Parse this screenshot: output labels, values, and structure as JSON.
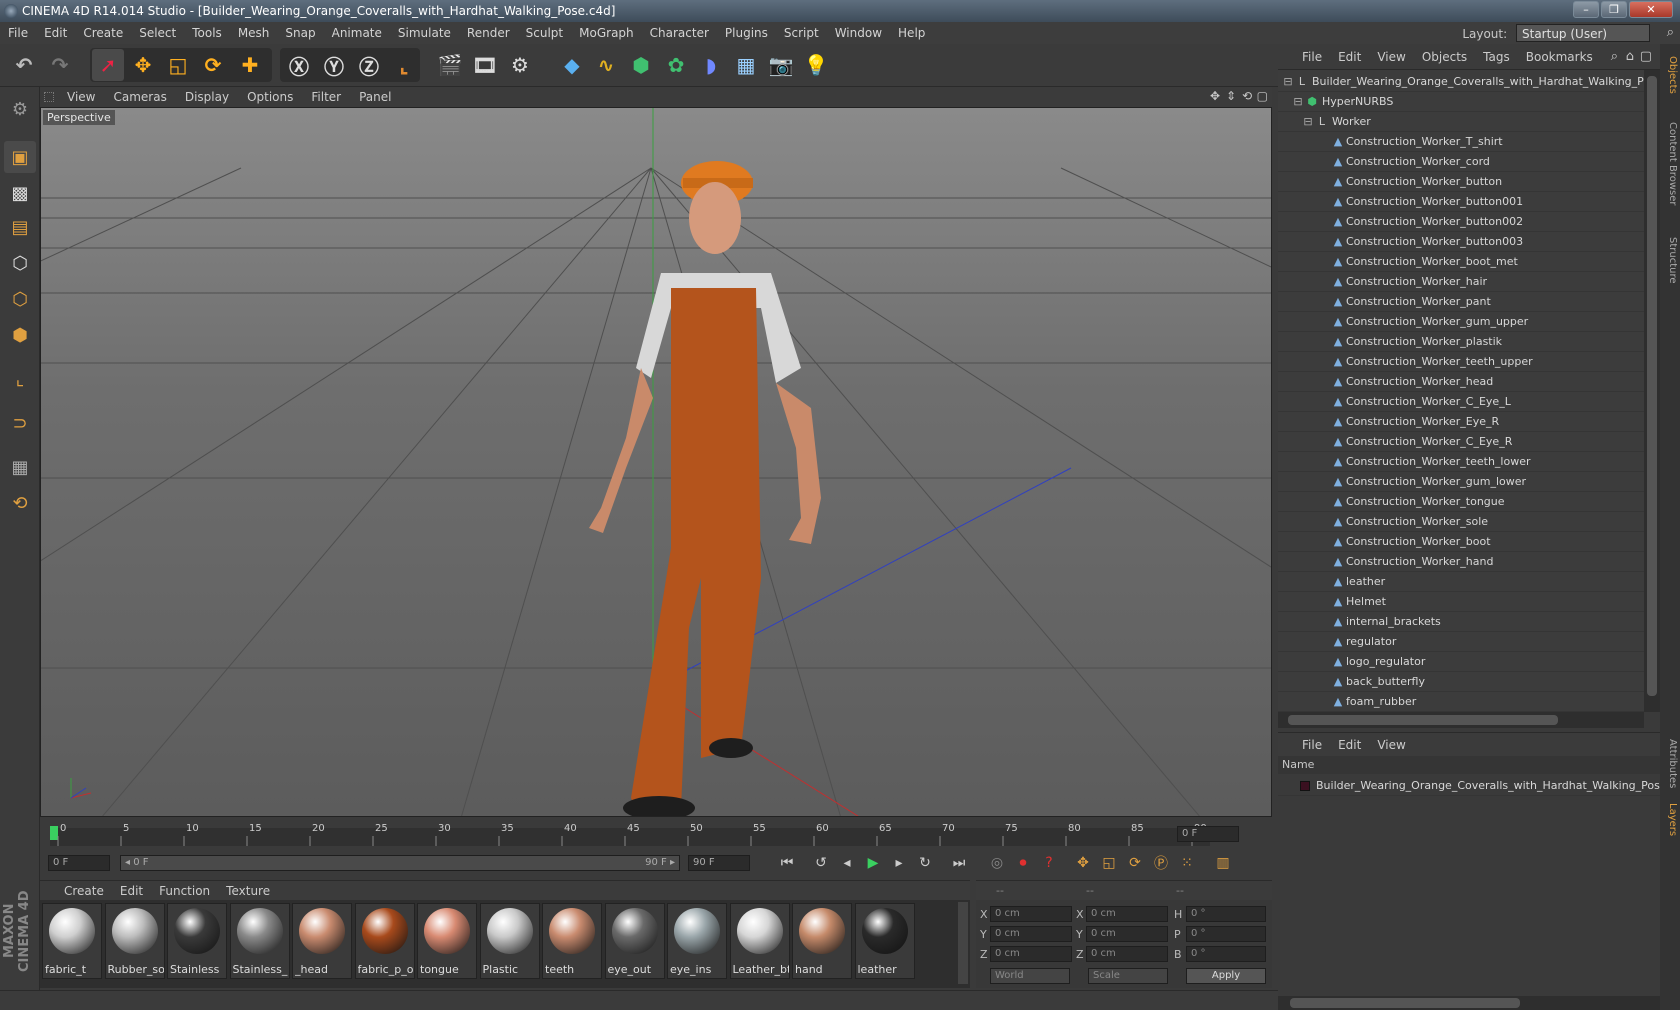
{
  "window": {
    "title": "CINEMA 4D R14.014 Studio - [Builder_Wearing_Orange_Coveralls_with_Hardhat_Walking_Pose.c4d]"
  },
  "menubar": {
    "items": [
      "File",
      "Edit",
      "Create",
      "Select",
      "Tools",
      "Mesh",
      "Snap",
      "Animate",
      "Simulate",
      "Render",
      "Sculpt",
      "MoGraph",
      "Character",
      "Plugins",
      "Script",
      "Window",
      "Help"
    ],
    "layout_label": "Layout:",
    "layout_value": "Startup (User)"
  },
  "viewport": {
    "menu": [
      "View",
      "Cameras",
      "Display",
      "Options",
      "Filter",
      "Panel"
    ],
    "label": "Perspective"
  },
  "timeline": {
    "ticks": [
      "0",
      "5",
      "10",
      "15",
      "20",
      "25",
      "30",
      "35",
      "40",
      "45",
      "50",
      "55",
      "60",
      "65",
      "70",
      "75",
      "80",
      "85",
      "90"
    ],
    "current_frame": "0 F",
    "start_field": "0 F",
    "range_start": "◂ 0 F",
    "range_end": "90 F ▸",
    "end_field": "90 F"
  },
  "material_manager": {
    "menu": [
      "Create",
      "Edit",
      "Function",
      "Texture"
    ],
    "materials": [
      {
        "name": "fabric_t",
        "color": "#cfcfcf"
      },
      {
        "name": "Rubber_so",
        "color": "#bdbdbd"
      },
      {
        "name": "Stainless",
        "color": "#3a3a3a"
      },
      {
        "name": "Stainless_",
        "color": "#8a8a8a"
      },
      {
        "name": "_head",
        "color": "#c98b6f"
      },
      {
        "name": "fabric_p_o",
        "color": "#a84a1c"
      },
      {
        "name": "tongue",
        "color": "#d88a72"
      },
      {
        "name": "Plastic",
        "color": "#c9c9c9"
      },
      {
        "name": "teeth",
        "color": "#c98b6f"
      },
      {
        "name": "eye_out",
        "color": "#6a6a6a"
      },
      {
        "name": "eye_ins",
        "color": "#9aa6aa"
      },
      {
        "name": "Leather_bt",
        "color": "#d6d6d6"
      },
      {
        "name": "hand",
        "color": "#c58a6a"
      },
      {
        "name": "leather",
        "color": "#2a2a2a"
      }
    ]
  },
  "coordinates": {
    "headers": [
      "--",
      "--",
      "--"
    ],
    "rows": [
      {
        "a": "X",
        "av": "0 cm",
        "b": "X",
        "bv": "0 cm",
        "c": "H",
        "cv": "0 °"
      },
      {
        "a": "Y",
        "av": "0 cm",
        "b": "Y",
        "bv": "0 cm",
        "c": "P",
        "cv": "0 °"
      },
      {
        "a": "Z",
        "av": "0 cm",
        "b": "Z",
        "bv": "0 cm",
        "c": "B",
        "cv": "0 °"
      }
    ],
    "mode1": "World",
    "mode2": "Scale",
    "apply": "Apply"
  },
  "object_manager": {
    "menu": [
      "File",
      "Edit",
      "View",
      "Objects",
      "Tags",
      "Bookmarks"
    ],
    "root": "Builder_Wearing_Orange_Coveralls_with_Hardhat_Walking_Pose",
    "hypernurbs": "HyperNURBS",
    "worker": "Worker",
    "children": [
      "Construction_Worker_T_shirt",
      "Construction_Worker_cord",
      "Construction_Worker_button",
      "Construction_Worker_button001",
      "Construction_Worker_button002",
      "Construction_Worker_button003",
      "Construction_Worker_boot_met",
      "Construction_Worker_hair",
      "Construction_Worker_pant",
      "Construction_Worker_gum_upper",
      "Construction_Worker_plastik",
      "Construction_Worker_teeth_upper",
      "Construction_Worker_head",
      "Construction_Worker_C_Eye_L",
      "Construction_Worker_Eye_R",
      "Construction_Worker_C_Eye_R",
      "Construction_Worker_teeth_lower",
      "Construction_Worker_gum_lower",
      "Construction_Worker_tongue",
      "Construction_Worker_sole",
      "Construction_Worker_boot",
      "Construction_Worker_hand",
      "leather",
      "Helmet",
      "internal_brackets",
      "regulator",
      "logo_regulator",
      "back_butterfly",
      "foam_rubber"
    ]
  },
  "layer_manager": {
    "menu": [
      "File",
      "Edit",
      "View"
    ],
    "column": "Name",
    "layer": "Builder_Wearing_Orange_Coveralls_with_Hardhat_Walking_Pose"
  },
  "side_tabs": [
    "Objects",
    "Content Browser",
    "Structure",
    "Attributes",
    "Layers"
  ],
  "branding": "MAXON CINEMA 4D"
}
